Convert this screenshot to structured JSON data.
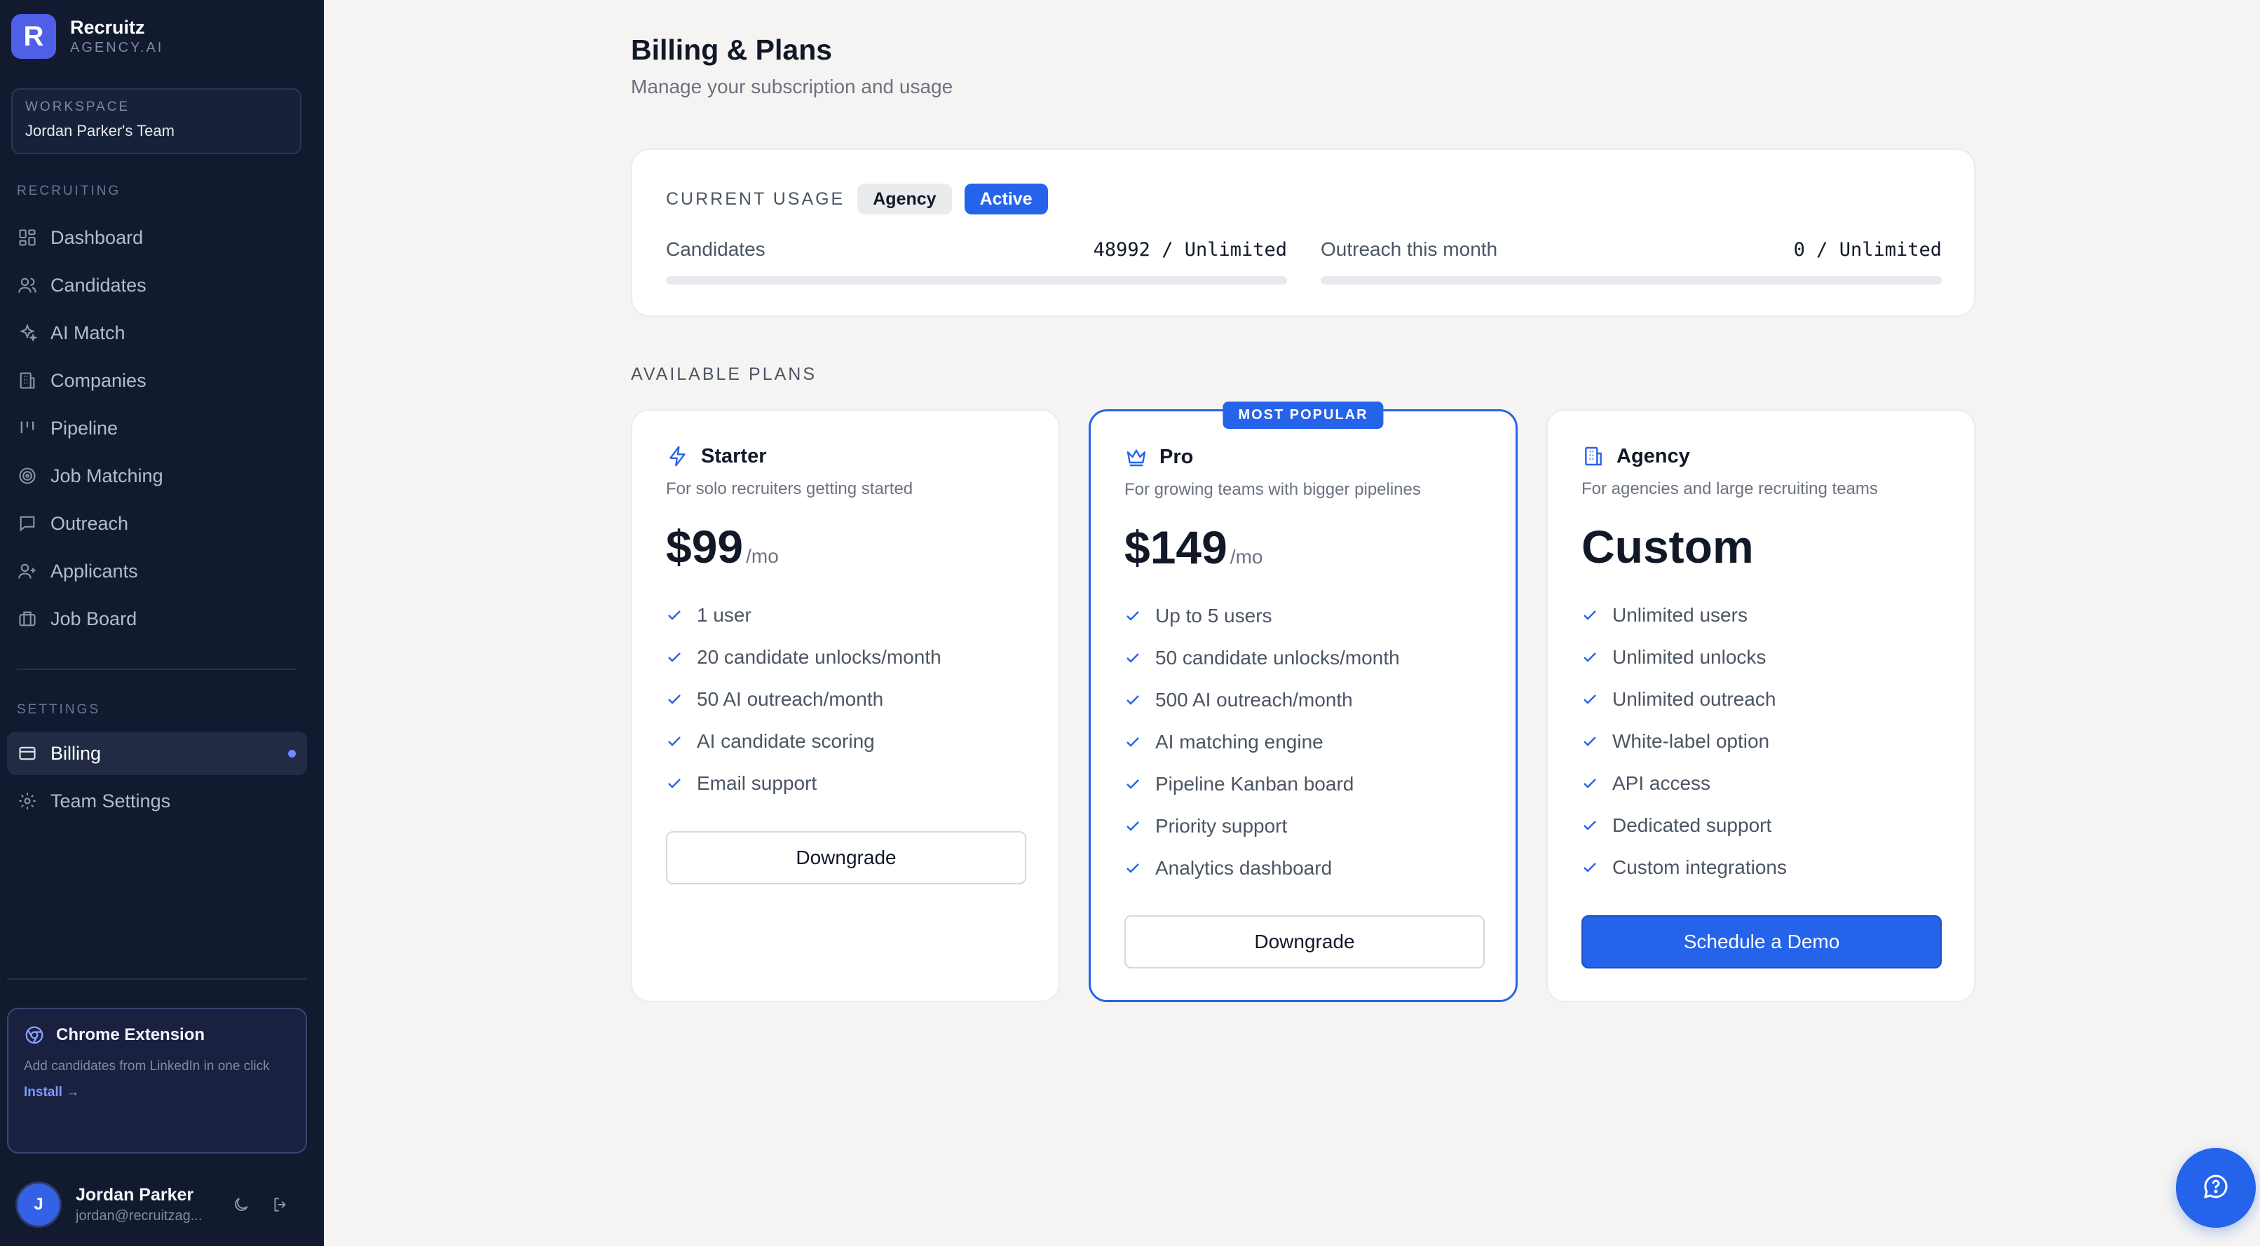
{
  "brand": {
    "logo_letter": "R",
    "name": "Recruitz",
    "sub": "AGENCY.AI"
  },
  "workspace": {
    "label": "WORKSPACE",
    "name": "Jordan Parker's Team"
  },
  "sidebar": {
    "recruiting_label": "RECRUITING",
    "recruiting_items": [
      {
        "label": "Dashboard",
        "icon": "dashboard-icon"
      },
      {
        "label": "Candidates",
        "icon": "users-icon"
      },
      {
        "label": "AI Match",
        "icon": "sparkles-icon"
      },
      {
        "label": "Companies",
        "icon": "building-icon"
      },
      {
        "label": "Pipeline",
        "icon": "kanban-icon"
      },
      {
        "label": "Job Matching",
        "icon": "target-icon"
      },
      {
        "label": "Outreach",
        "icon": "message-icon"
      },
      {
        "label": "Applicants",
        "icon": "user-plus-icon"
      },
      {
        "label": "Job Board",
        "icon": "briefcase-icon"
      }
    ],
    "settings_label": "SETTINGS",
    "settings_items": [
      {
        "label": "Billing",
        "icon": "credit-card-icon",
        "active": true
      },
      {
        "label": "Team Settings",
        "icon": "gear-icon",
        "active": false
      }
    ]
  },
  "chrome_extension": {
    "title": "Chrome Extension",
    "description": "Add candidates from LinkedIn in one click",
    "install_label": "Install →"
  },
  "user": {
    "initial": "J",
    "name": "Jordan Parker",
    "email": "jordan@recruitzag..."
  },
  "page": {
    "title": "Billing & Plans",
    "subtitle": "Manage your subscription and usage"
  },
  "usage": {
    "label": "CURRENT USAGE",
    "plan_badge": "Agency",
    "status_badge": "Active",
    "meters": [
      {
        "name": "Candidates",
        "value": "48992 / Unlimited",
        "fill_fraction": 0
      },
      {
        "name": "Outreach this month",
        "value": "0 / Unlimited",
        "fill_fraction": 0
      }
    ]
  },
  "plans_label": "AVAILABLE PLANS",
  "plans": [
    {
      "name": "Starter",
      "icon": "lightning-icon",
      "description": "For solo recruiters getting started",
      "price": "$99",
      "period": "/mo",
      "features": [
        "1 user",
        "20 candidate unlocks/month",
        "50 AI outreach/month",
        "AI candidate scoring",
        "Email support"
      ],
      "button": "Downgrade"
    },
    {
      "name": "Pro",
      "icon": "crown-icon",
      "badge": "MOST POPULAR",
      "description": "For growing teams with bigger pipelines",
      "price": "$149",
      "period": "/mo",
      "features": [
        "Up to 5 users",
        "50 candidate unlocks/month",
        "500 AI outreach/month",
        "AI matching engine",
        "Pipeline Kanban board",
        "Priority support",
        "Analytics dashboard"
      ],
      "button": "Downgrade"
    },
    {
      "name": "Agency",
      "icon": "building-icon",
      "description": "For agencies and large recruiting teams",
      "price": "Custom",
      "period": "",
      "features": [
        "Unlimited users",
        "Unlimited unlocks",
        "Unlimited outreach",
        "White-label option",
        "API access",
        "Dedicated support",
        "Custom integrations"
      ],
      "button": "Schedule a Demo"
    }
  ],
  "colors": {
    "accent": "#2563eb",
    "sidebar_bg": "#121a2f",
    "page_bg": "#f5f4f2"
  }
}
